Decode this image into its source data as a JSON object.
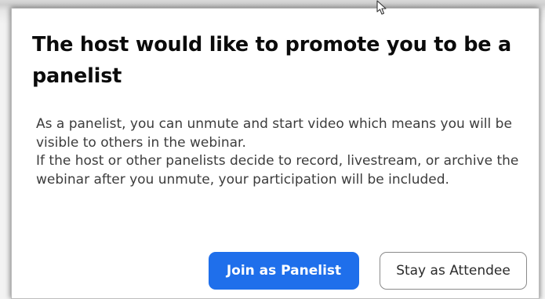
{
  "dialog": {
    "title": "The host would like to promote you to be a panelist",
    "paragraphs": [
      "As a panelist, you can unmute and start video which means you will be visible to others in the webinar.",
      "If the host or other panelists decide to record, livestream, or archive the webinar after you unmute, your participation will be included."
    ],
    "primary_button": "Join as Panelist",
    "secondary_button": "Stay as Attendee"
  },
  "colors": {
    "primary": "#1f6feb",
    "title_text": "#0b0b0b",
    "body_text": "#3c3c3c"
  },
  "icons": {
    "cursor": "mouse-pointer-icon"
  }
}
